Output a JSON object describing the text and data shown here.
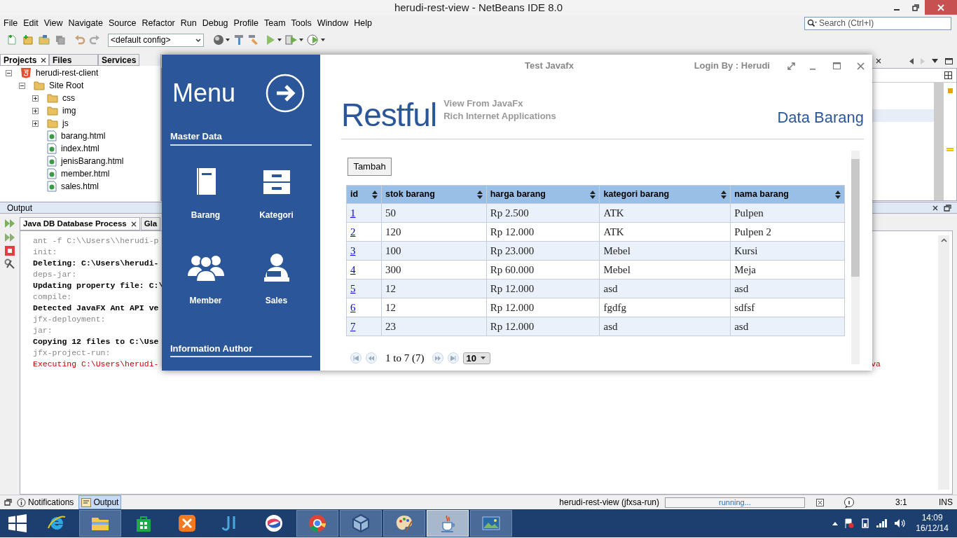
{
  "window": {
    "title": "herudi-rest-view - NetBeans IDE 8.0"
  },
  "menu": [
    "File",
    "Edit",
    "View",
    "Navigate",
    "Source",
    "Refactor",
    "Run",
    "Debug",
    "Profile",
    "Team",
    "Tools",
    "Window",
    "Help"
  ],
  "toolbar": {
    "config": "<default config>",
    "search_placeholder": "Search (Ctrl+I)"
  },
  "projects_panel": {
    "tabs": [
      {
        "label": "Projects",
        "selected": true
      },
      {
        "label": "Files",
        "selected": false
      },
      {
        "label": "Services",
        "selected": false
      }
    ],
    "tree": [
      {
        "label": "herudi-rest-client",
        "kind": "project",
        "expanded": true,
        "children": [
          {
            "label": "Site Root",
            "kind": "folder",
            "expanded": true,
            "children": [
              {
                "label": "css",
                "kind": "folder",
                "expanded": false
              },
              {
                "label": "img",
                "kind": "folder",
                "expanded": false
              },
              {
                "label": "js",
                "kind": "folder",
                "expanded": false
              },
              {
                "label": "barang.html",
                "kind": "file"
              },
              {
                "label": "index.html",
                "kind": "file"
              },
              {
                "label": "jenisBarang.html",
                "kind": "file"
              },
              {
                "label": "member.html",
                "kind": "file"
              },
              {
                "label": "sales.html",
                "kind": "file"
              }
            ]
          }
        ]
      }
    ]
  },
  "output": {
    "title": "Output",
    "tabs": [
      {
        "label": "Java DB Database Process",
        "selected": true
      },
      {
        "label": "Gla",
        "selected": false
      }
    ],
    "lines": [
      {
        "text": "ant -f C:\\\\Users\\\\herudi-p",
        "kind": "info"
      },
      {
        "text": "init:",
        "kind": "info"
      },
      {
        "text": "Deleting: C:\\Users\\herudi-",
        "kind": "normal"
      },
      {
        "text": "deps-jar:",
        "kind": "info"
      },
      {
        "text": "Updating property file: C:\\",
        "kind": "normal"
      },
      {
        "text": "compile:",
        "kind": "info"
      },
      {
        "text": "Detected JavaFX Ant API ve",
        "kind": "normal"
      },
      {
        "text": "jfx-deployment:",
        "kind": "info"
      },
      {
        "text": "jar:",
        "kind": "info"
      },
      {
        "text": "Copying 12 files to C:\\Use",
        "kind": "normal"
      },
      {
        "text": "jfx-project-run:",
        "kind": "info"
      },
      {
        "text": "Executing C:\\Users\\herudi-",
        "kind": "error",
        "tail": "va"
      }
    ]
  },
  "status_bar": {
    "tabs": [
      {
        "label": "Notifications",
        "selected": false
      },
      {
        "label": "Output",
        "selected": true
      }
    ],
    "task": "herudi-rest-view (jfxsa-run)",
    "progress": "running...",
    "position": "3:1",
    "mode": "INS"
  },
  "app": {
    "title": "Test Javafx",
    "login": "Login By : Herudi",
    "menu_title": "Menu",
    "master_data": {
      "title": "Master Data",
      "items": [
        {
          "label": "Barang",
          "kind": "book"
        },
        {
          "label": "Kategori",
          "kind": "cabinet"
        },
        {
          "label": "Member",
          "kind": "group"
        },
        {
          "label": "Sales",
          "kind": "user"
        }
      ]
    },
    "author_title": "Information Author",
    "brand": "Restful",
    "subtitle": [
      "View From JavaFx",
      "Rich Internet Applications"
    ],
    "page_title": "Data Barang",
    "add_button": "Tambah",
    "table": {
      "columns": [
        "id",
        "stok barang",
        "harga barang",
        "kategori barang",
        "nama barang"
      ],
      "rows": [
        [
          "1",
          "50",
          "Rp 2.500",
          "ATK",
          "Pulpen"
        ],
        [
          "2",
          "120",
          "Rp 12.000",
          "ATK",
          "Pulpen 2"
        ],
        [
          "3",
          "100",
          "Rp 23.000",
          "Mebel",
          "Kursi"
        ],
        [
          "4",
          "300",
          "Rp 60.000",
          "Mebel",
          "Meja"
        ],
        [
          "5",
          "12",
          "Rp 12.000",
          "asd",
          "asd"
        ],
        [
          "6",
          "12",
          "Rp 12.000",
          "fgdfg",
          "sdfsf"
        ],
        [
          "7",
          "23",
          "Rp 12.000",
          "asd",
          "asd"
        ]
      ]
    },
    "pager": {
      "summary": "1 to 7 (7)",
      "page_size": "10"
    }
  },
  "taskbar": {
    "apps": [
      {
        "kind": "ie",
        "running": false
      },
      {
        "kind": "explorer",
        "running": true
      },
      {
        "kind": "store",
        "running": false
      },
      {
        "kind": "xampp",
        "running": false
      },
      {
        "kind": "ji",
        "running": false
      },
      {
        "kind": "swirl",
        "running": false
      },
      {
        "kind": "chrome",
        "running": true
      },
      {
        "kind": "cube",
        "running": true
      },
      {
        "kind": "paint",
        "running": true
      },
      {
        "kind": "java",
        "running": true,
        "selected": true
      },
      {
        "kind": "photo",
        "running": true
      }
    ],
    "time": "14:09",
    "date": "16/12/14"
  }
}
